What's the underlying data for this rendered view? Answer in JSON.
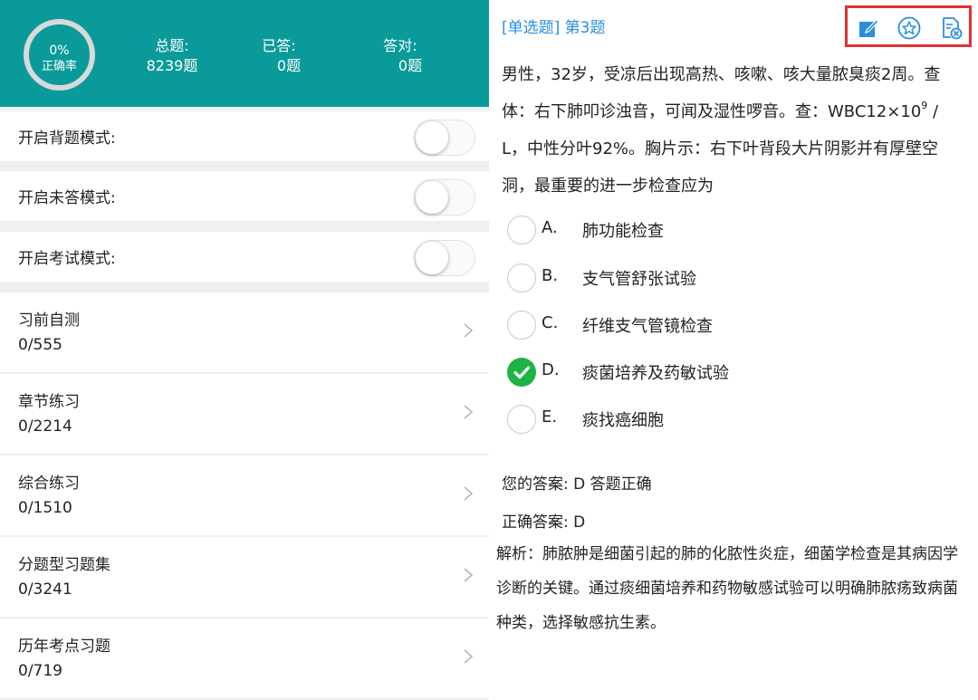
{
  "stats": {
    "accuracy_pct": "0%",
    "accuracy_label": "正确率",
    "total_label": "总题:",
    "total_value": "8239题",
    "answered_label": "已答:",
    "answered_value": "0题",
    "correct_label": "答对:",
    "correct_value": "0题"
  },
  "modes": [
    {
      "label": "开启背题模式:",
      "on": false
    },
    {
      "label": "开启未答模式:",
      "on": false
    },
    {
      "label": "开启考试模式:",
      "on": false
    }
  ],
  "sections": [
    {
      "title": "习前自测",
      "count": "0/555"
    },
    {
      "title": "章节练习",
      "count": "0/2214"
    },
    {
      "title": "综合练习",
      "count": "0/1510"
    },
    {
      "title": "分题型习题集",
      "count": "0/3241"
    },
    {
      "title": "历年考点习题",
      "count": "0/719"
    }
  ],
  "question": {
    "type_label": "[单选题] 第3题",
    "stem_1": "男性，32岁，受凉后出现高热、咳嗽、咳大量脓臭痰2周。查体：右下肺叩诊浊音，可闻及湿性啰音。查：WBC12×10",
    "stem_sup": "9",
    "stem_2": " / L，中性分叶92%。胸片示：右下叶背段大片阴影并有厚壁空洞，最重要的进一步检查应为",
    "options": [
      {
        "key": "A.",
        "text": "肺功能检查",
        "selected": false
      },
      {
        "key": "B.",
        "text": "支气管舒张试验",
        "selected": false
      },
      {
        "key": "C.",
        "text": "纤维支气管镜检查",
        "selected": false
      },
      {
        "key": "D.",
        "text": "痰菌培养及药敏试验",
        "selected": true
      },
      {
        "key": "E.",
        "text": "痰找癌细胞",
        "selected": false
      }
    ],
    "your_answer": "您的答案:  D 答题正确",
    "correct_answer": "正确答案:  D",
    "explanation": "解析：肺脓肿是细菌引起的肺的化脓性炎症，细菌学检查是其病因学诊断的关键。通过痰细菌培养和药物敏感试验可以明确肺脓疡致病菌种类，选择敏感抗生素。"
  },
  "toolbar": {
    "icons": [
      "edit-note-icon",
      "favorite-star-icon",
      "delete-record-icon"
    ],
    "accent": "#2a8ee0",
    "highlight": "#e03030"
  },
  "colors": {
    "header_teal": "#0b9a9a",
    "correct_green": "#1db345"
  }
}
